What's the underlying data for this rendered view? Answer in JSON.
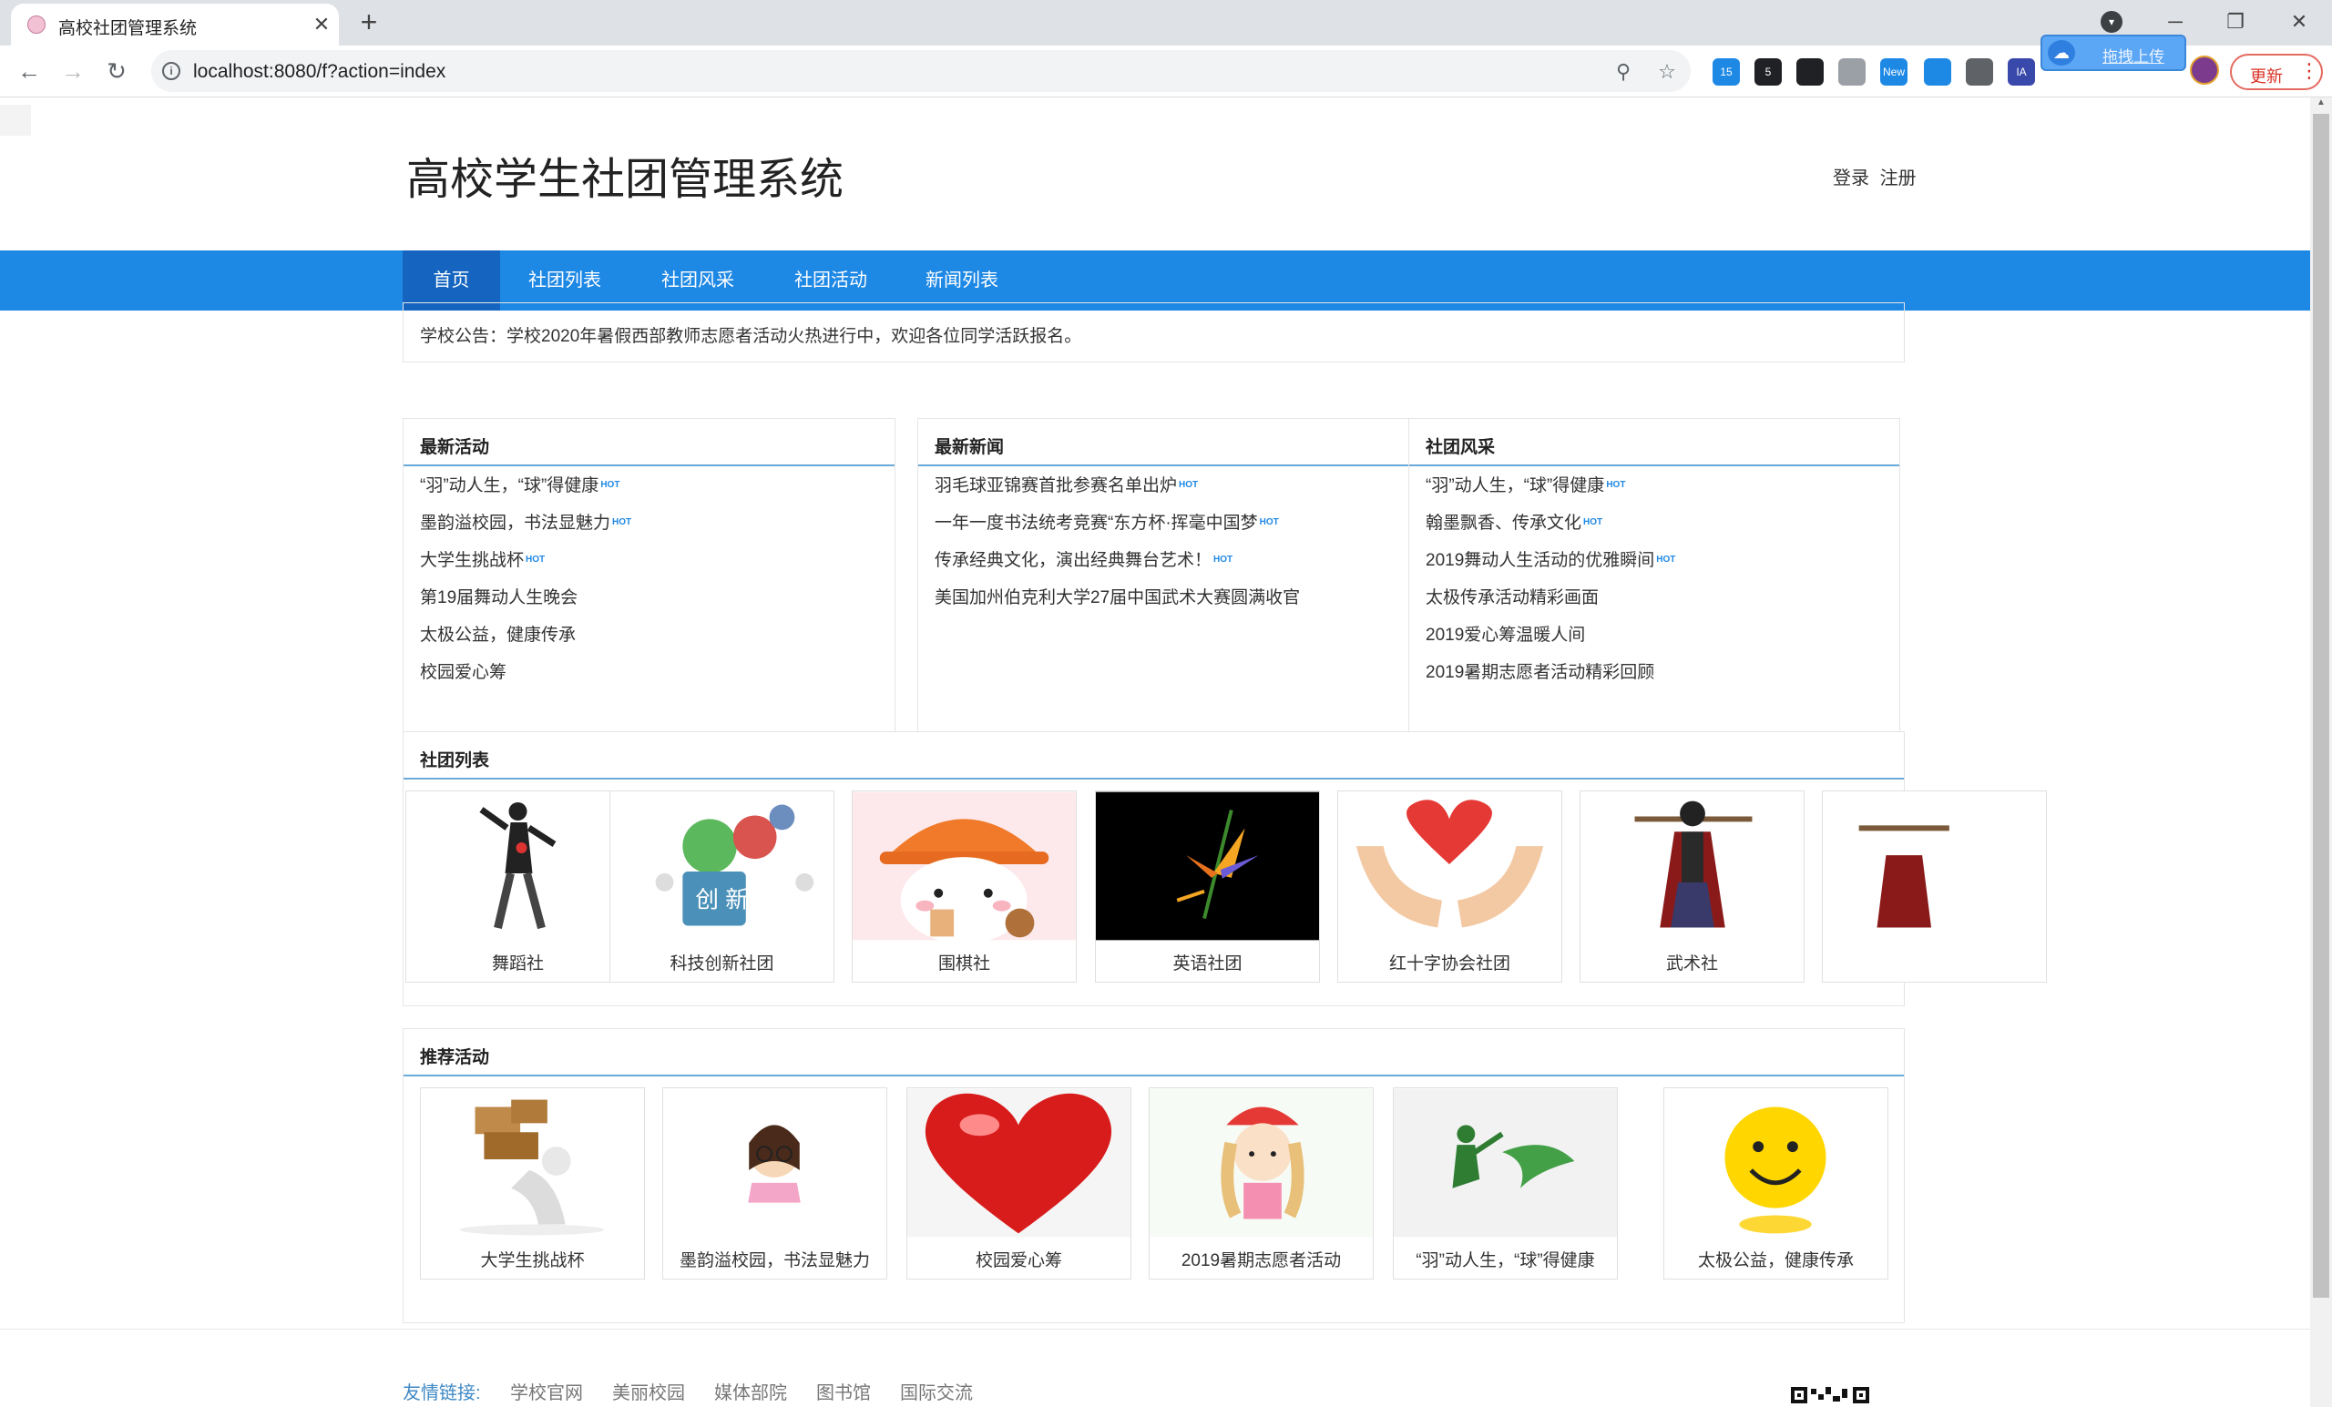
{
  "browser": {
    "tab_title": "高校社团管理系统",
    "url": "localhost:8080/f?action=index",
    "extensions": [
      {
        "name": "grid-extension-icon",
        "badge": "15",
        "color": "#1e88e5"
      },
      {
        "name": "mail-extension-icon",
        "badge": "5",
        "color": "#202124"
      },
      {
        "name": "infinity-extension-icon",
        "badge": "",
        "color": "#202124"
      },
      {
        "name": "cursor-extension-icon",
        "badge": "",
        "color": "#9aa0a6"
      },
      {
        "name": "new-extension-icon",
        "badge": "New",
        "color": "#1e88e5"
      },
      {
        "name": "tag-extension-icon",
        "badge": "",
        "color": "#1e88e5"
      },
      {
        "name": "vue-extension-icon",
        "badge": "",
        "color": "#5f6368"
      },
      {
        "name": "ia-extension-icon",
        "badge": "IA",
        "color": "#3949ab"
      }
    ],
    "upload_label": "拖拽上传",
    "update_label": "更新"
  },
  "site": {
    "title": "高校学生社团管理系统",
    "login": "登录",
    "register": "注册"
  },
  "nav": [
    "首页",
    "社团列表",
    "社团风采",
    "社团活动",
    "新闻列表"
  ],
  "notice": "学校公告：学校2020年暑假西部教师志愿者活动火热进行中，欢迎各位同学活跃报名。",
  "hot_label": "HOT",
  "latest_activities": {
    "title": "最新活动",
    "items": [
      {
        "text": "“羽”动人生，“球”得健康",
        "hot": true
      },
      {
        "text": "墨韵溢校园，书法显魅力",
        "hot": true
      },
      {
        "text": "大学生挑战杯",
        "hot": true
      },
      {
        "text": "第19届舞动人生晚会",
        "hot": false
      },
      {
        "text": "太极公益，健康传承",
        "hot": false
      },
      {
        "text": "校园爱心筹",
        "hot": false
      }
    ]
  },
  "latest_news": {
    "title": "最新新闻",
    "items": [
      {
        "text": "羽毛球亚锦赛首批参赛名单出炉",
        "hot": true
      },
      {
        "text": "一年一度书法统考竞赛“东方杯·挥毫中国梦",
        "hot": true
      },
      {
        "text": "传承经典文化，演出经典舞台艺术！",
        "hot": true
      },
      {
        "text": "美国加州伯克利大学27届中国武术大赛圆满收官",
        "hot": false
      }
    ]
  },
  "club_style": {
    "title": "社团风采",
    "items": [
      {
        "text": "“羽”动人生，“球”得健康",
        "hot": true
      },
      {
        "text": "翰墨飘香、传承文化",
        "hot": true
      },
      {
        "text": "2019舞动人生活动的优雅瞬间",
        "hot": true
      },
      {
        "text": "太极传承活动精彩画面",
        "hot": false
      },
      {
        "text": "2019爱心筹温暖人间",
        "hot": false
      },
      {
        "text": "2019暑期志愿者活动精彩回顾",
        "hot": false
      }
    ]
  },
  "club_list": {
    "title": "社团列表",
    "items": [
      "舞蹈社",
      "科技创新社团",
      "围棋社",
      "英语社团",
      "红十字协会社团",
      "武术社",
      ""
    ]
  },
  "recommended": {
    "title": "推荐活动",
    "items": [
      "大学生挑战杯",
      "墨韵溢校园，书法显魅力",
      "校园爱心筹",
      "2019暑期志愿者活动",
      "“羽”动人生，“球”得健康",
      "太极公益，健康传承"
    ]
  },
  "footer": {
    "friend_label": "友情链接:",
    "links": [
      "学校官网",
      "美丽校园",
      "媒体部院",
      "图书馆",
      "国际交流"
    ]
  },
  "colors": {
    "nav_bar": "#1e88e5",
    "nav_active": "#1565c0",
    "panel_underline": "#6aa9d8",
    "hot": "#1e88e5",
    "update_red": "#d93025"
  }
}
